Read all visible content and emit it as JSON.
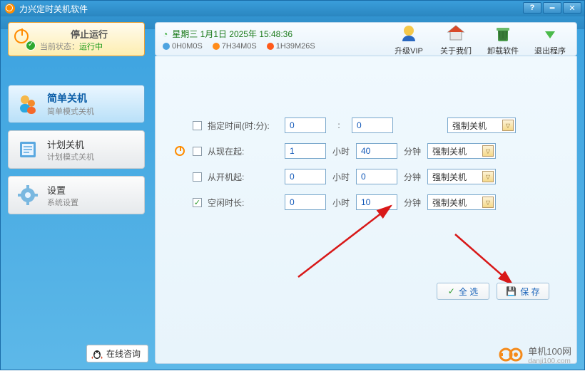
{
  "title": "力兴定时关机软件",
  "status": {
    "line1": "停止运行",
    "prefix": "当前状态：",
    "state": "运行中"
  },
  "nav": {
    "simple": {
      "title": "简单关机",
      "sub": "简单模式关机"
    },
    "plan": {
      "title": "计划关机",
      "sub": "计划模式关机"
    },
    "settings": {
      "title": "设置",
      "sub": "系统设置"
    }
  },
  "online_label": "在线咨询",
  "clock": {
    "datetime": "星期三 1月1日 2025年 15:48:36",
    "t1": "0H0M0S",
    "t2": "7H34M0S",
    "t3": "1H39M26S"
  },
  "tools": {
    "vip": "升级VIP",
    "about": "关于我们",
    "uninstall": "卸载软件",
    "exit": "退出程序"
  },
  "form": {
    "row1_label": "指定时间(时:分):",
    "row2_label": "从现在起:",
    "row3_label": "从开机起:",
    "row4_label": "空闲时长:",
    "hour_unit": "小时",
    "min_unit": "分钟",
    "colon": ":",
    "r1_h": "0",
    "r1_m": "0",
    "r2_h": "1",
    "r2_m": "40",
    "r3_h": "0",
    "r3_m": "0",
    "r4_h": "0",
    "r4_m": "10",
    "action_option": "强制关机"
  },
  "buttons": {
    "select_all": "全 选",
    "save": "保 存"
  },
  "watermark": {
    "brand": "单机100网",
    "url": "danji100.com"
  }
}
